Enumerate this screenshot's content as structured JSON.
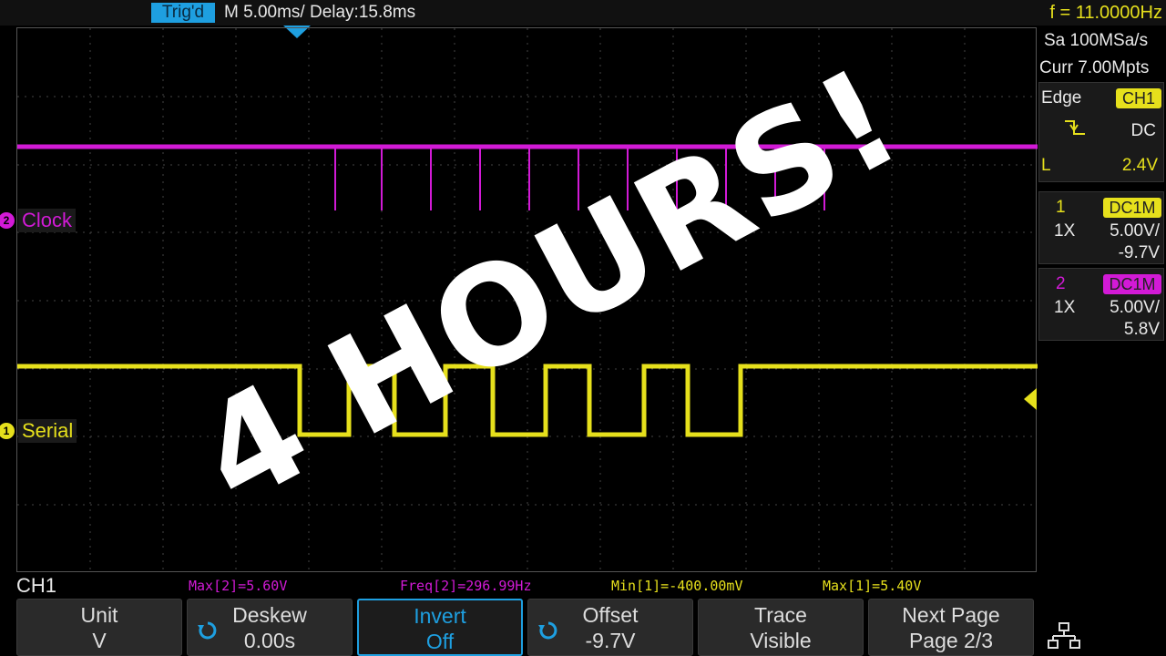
{
  "top_bar": {
    "trigger_status": "Trig'd",
    "timebase": "M 5.00ms/ Delay:15.8ms",
    "frequency": "f = 11.0000Hz"
  },
  "acquisition": {
    "sample_rate": "Sa 100MSa/s",
    "memory_depth": "Curr 7.00Mpts"
  },
  "trigger": {
    "type": "Edge",
    "source": "CH1",
    "slope_icon": "rising-falling-edge-icon",
    "coupling": "DC",
    "level_label": "L",
    "level": "2.4V"
  },
  "channels": [
    {
      "number": "1",
      "coupling": "DC1M",
      "probe": "1X",
      "scale": "5.00V/",
      "offset": "-9.7V",
      "color": "#e6e01c"
    },
    {
      "number": "2",
      "coupling": "DC1M",
      "probe": "1X",
      "scale": "5.00V/",
      "offset": "5.8V",
      "color": "#d21ad6"
    }
  ],
  "traces": {
    "clock_label": "Clock",
    "clock_marker": "2",
    "serial_label": "Serial",
    "serial_marker": "1"
  },
  "footer": {
    "active_channel": "CH1",
    "measurements": [
      {
        "text": "Max[2]=5.60V",
        "color": "#d21ad6"
      },
      {
        "text": "Freq[2]=296.99Hz",
        "color": "#d21ad6"
      },
      {
        "text": "Min[1]=-400.00mV",
        "color": "#e6e01c"
      },
      {
        "text": "Max[1]=5.40V",
        "color": "#e6e01c"
      }
    ]
  },
  "softkeys": [
    {
      "line1": "Unit",
      "line2": "V"
    },
    {
      "line1": "Deskew",
      "line2": "0.00s"
    },
    {
      "line1": "Invert",
      "line2": "Off"
    },
    {
      "line1": "Offset",
      "line2": "-9.7V"
    },
    {
      "line1": "Trace",
      "line2": "Visible"
    },
    {
      "line1": "Next Page",
      "line2": "Page 2/3"
    }
  ],
  "overlay_text": "4 HOURS!",
  "colors": {
    "accent": "#1e9fe0",
    "ch1": "#e6e01c",
    "ch2": "#d21ad6"
  }
}
